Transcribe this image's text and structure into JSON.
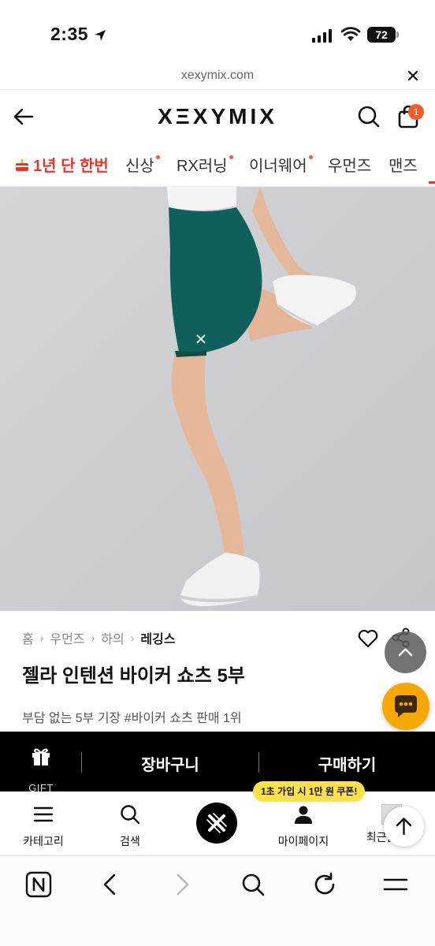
{
  "status_bar": {
    "time": "2:35",
    "battery": "72"
  },
  "url_bar": {
    "domain": "xexymix.com"
  },
  "header": {
    "logo": "XΞXYMIX",
    "cart_count": "1"
  },
  "category_nav": {
    "items": [
      {
        "label": "1년 단 한번",
        "highlight": true,
        "dot": false
      },
      {
        "label": "신상",
        "highlight": false,
        "dot": true
      },
      {
        "label": "RX러닝",
        "highlight": false,
        "dot": true
      },
      {
        "label": "이너웨어",
        "highlight": false,
        "dot": true
      },
      {
        "label": "우먼즈",
        "highlight": false,
        "dot": false
      },
      {
        "label": "맨즈",
        "highlight": false,
        "dot": false
      }
    ]
  },
  "product": {
    "breadcrumb": [
      "홈",
      "우먼즈",
      "하의",
      "레깅스"
    ],
    "title": "젤라 인텐션 바이커 쇼츠 5부",
    "subtitle": "부담 없는 5부 기장 #바이커 쇼츠 판매 1위"
  },
  "purchase_bar": {
    "gift_label": "GIFT",
    "cart_label": "장바구니",
    "buy_label": "구매하기"
  },
  "tab_bar": {
    "coupon_text": "1초 가입 시 1만 원 쿠폰!",
    "items": [
      {
        "label": "카테고리"
      },
      {
        "label": "검색"
      },
      {
        "label": ""
      },
      {
        "label": "마이페이지"
      },
      {
        "label": "최근본상품"
      }
    ]
  },
  "colors": {
    "accent": "#e5372b",
    "badge": "#f35b2f",
    "chat": "#f6a800",
    "coupon": "#ffe14a",
    "shorts": "#0f5f5a"
  }
}
